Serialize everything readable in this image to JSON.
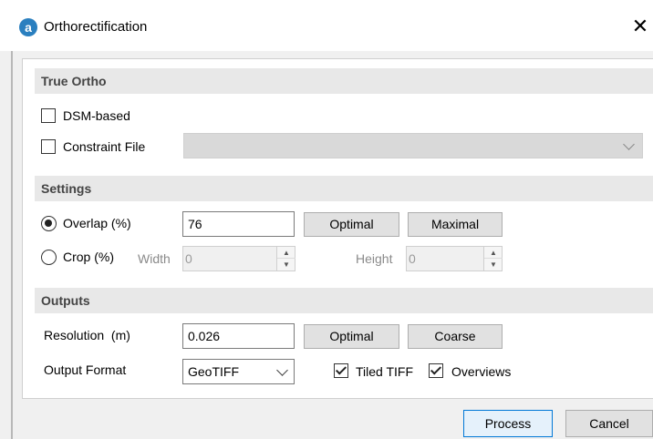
{
  "window": {
    "title": "Orthorectification",
    "close_symbol": "✕",
    "app_icon_letter": "a"
  },
  "true_ortho": {
    "header": "True Ortho",
    "dsm_label": "DSM-based",
    "dsm_checked": false,
    "constraint_label": "Constraint File",
    "constraint_checked": false,
    "constraint_value": ""
  },
  "settings": {
    "header": "Settings",
    "overlap_label": "Overlap (%)",
    "overlap_selected": true,
    "overlap_value": "76",
    "optimal_label": "Optimal",
    "maximal_label": "Maximal",
    "crop_label": "Crop (%)",
    "crop_selected": false,
    "width_label": "Width",
    "width_value": "0",
    "height_label": "Height",
    "height_value": "0"
  },
  "outputs": {
    "header": "Outputs",
    "resolution_label": "Resolution  (m)",
    "resolution_value": "0.026",
    "optimal_label": "Optimal",
    "coarse_label": "Coarse",
    "format_label": "Output Format",
    "format_value": "GeoTIFF",
    "tiled_label": "Tiled TIFF",
    "tiled_checked": true,
    "overviews_label": "Overviews",
    "overviews_checked": true
  },
  "footer": {
    "process_label": "Process",
    "cancel_label": "Cancel"
  }
}
